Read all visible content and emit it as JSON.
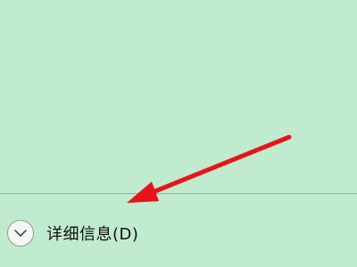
{
  "dialog": {
    "details_toggle": {
      "label": "详细信息(D)",
      "icon": "chevron-down-icon",
      "expanded": false
    }
  },
  "colors": {
    "background": "#c0ebcf",
    "divider": "#9aa59d",
    "annotation_arrow": "#e8141a"
  },
  "annotation": {
    "icon": "red-arrow-icon"
  }
}
